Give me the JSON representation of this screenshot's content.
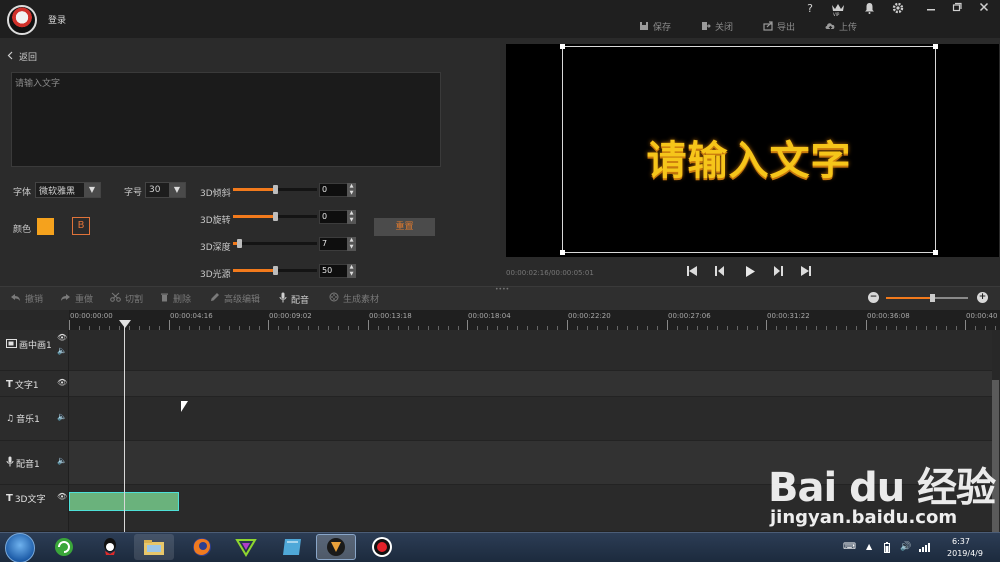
{
  "titlebar": {
    "login_label": "登录",
    "window_icons": [
      "help-icon",
      "vip-icon",
      "bell-icon",
      "gear-icon",
      "minimize-icon",
      "restore-icon",
      "close-icon"
    ],
    "vip_label": "VIP",
    "actions": [
      {
        "label": "保存",
        "icon": "save-icon"
      },
      {
        "label": "关闭",
        "icon": "exit-icon"
      },
      {
        "label": "导出",
        "icon": "export-icon"
      },
      {
        "label": "上传",
        "icon": "upload-icon"
      }
    ]
  },
  "editor": {
    "back_label": "返回",
    "text_placeholder": "请输入文字",
    "font_label": "字体",
    "font_value": "微软雅黑",
    "size_label": "字号",
    "size_value": "30",
    "color_label": "颜色",
    "color_value": "#f5a21d",
    "bold_label": "B",
    "reset_label": "重置",
    "sliders": [
      {
        "label": "3D倾斜",
        "value": "0",
        "level": 0.5
      },
      {
        "label": "3D旋转",
        "value": "0",
        "level": 0.5
      },
      {
        "label": "3D深度",
        "value": "7",
        "level": 0.07
      },
      {
        "label": "3D光源",
        "value": "50",
        "level": 0.5
      }
    ]
  },
  "preview": {
    "text": "请输入文字",
    "text_color": "#f6c51a",
    "timecode": "00:00:02:16/00:00:05:01",
    "controls": [
      "skip-start-icon",
      "step-back-icon",
      "play-icon",
      "step-forward-icon",
      "skip-end-icon"
    ]
  },
  "toolbar": {
    "buttons": [
      {
        "label": "撤销",
        "icon": "undo-icon",
        "active": false
      },
      {
        "label": "重做",
        "icon": "redo-icon",
        "active": false
      },
      {
        "label": "切割",
        "icon": "scissors-icon",
        "active": false
      },
      {
        "label": "删除",
        "icon": "trash-icon",
        "active": false
      },
      {
        "label": "高级编辑",
        "icon": "pencil-icon",
        "active": false
      },
      {
        "label": "配音",
        "icon": "microphone-icon",
        "active": true
      },
      {
        "label": "生成素材",
        "icon": "film-icon",
        "active": false
      }
    ],
    "zoom_level": 0.56
  },
  "timeline": {
    "ticks": [
      "00:00:00:00",
      "00:00:04:16",
      "00:00:09:02",
      "00:00:13:18",
      "00:00:18:04",
      "00:00:22:20",
      "00:00:27:06",
      "00:00:31:22",
      "00:00:36:08",
      "00:00:40"
    ],
    "tracks": [
      {
        "label": "画中画1",
        "icon": "pip-icon"
      },
      {
        "label": "文字1",
        "icon": "text-icon"
      },
      {
        "label": "音乐1",
        "icon": "music-icon"
      },
      {
        "label": "配音1",
        "icon": "microphone-icon"
      },
      {
        "label": "3D文字",
        "icon": "text-icon"
      }
    ],
    "clip_color": "#6ab27c"
  },
  "taskbar": {
    "time": "6:37",
    "date": "2019/4/9"
  },
  "watermark": {
    "logo": "Bai du 经验",
    "url": "jingyan.baidu.com"
  }
}
